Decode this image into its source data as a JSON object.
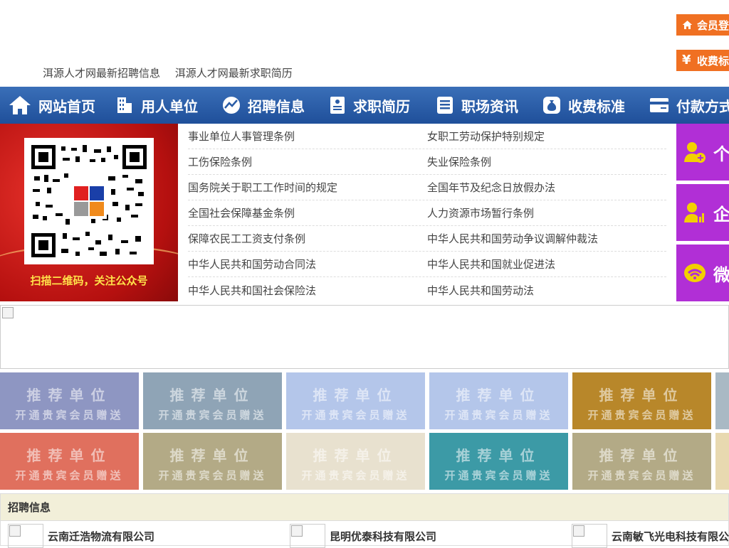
{
  "top_links": [
    "洱源人才网最新招聘信息",
    "洱源人才网最新求职简历"
  ],
  "side_buttons": [
    {
      "label": "会员登",
      "icon": "home-icon"
    },
    {
      "label": "收费标",
      "icon": "yen-icon"
    }
  ],
  "nav": [
    {
      "label": "网站首页",
      "icon": "home-icon"
    },
    {
      "label": "用人单位",
      "icon": "building-icon"
    },
    {
      "label": "招聘信息",
      "icon": "chart-icon"
    },
    {
      "label": "求职简历",
      "icon": "resume-icon"
    },
    {
      "label": "职场资讯",
      "icon": "news-icon"
    },
    {
      "label": "收费标准",
      "icon": "moneybag-icon"
    },
    {
      "label": "付款方式",
      "icon": "card-icon"
    }
  ],
  "qr": {
    "caption": "扫描二维码，关注公众号"
  },
  "laws": [
    [
      "事业单位人事管理条例",
      "女职工劳动保护特别规定"
    ],
    [
      "工伤保险条例",
      "失业保险条例"
    ],
    [
      "国务院关于职工工作时间的规定",
      "全国年节及纪念日放假办法"
    ],
    [
      "全国社会保障基金条例",
      "人力资源市场暂行条例"
    ],
    [
      "保障农民工工资支付条例",
      "中华人民共和国劳动争议调解仲裁法"
    ],
    [
      "中华人民共和国劳动合同法",
      "中华人民共和国就业促进法"
    ],
    [
      "中华人民共和国社会保险法",
      "中华人民共和国劳动法"
    ]
  ],
  "purple_tiles": [
    {
      "label": "个",
      "icon": "person-add-icon"
    },
    {
      "label": "企",
      "icon": "person-chart-icon"
    },
    {
      "label": "微",
      "icon": "wechat-icon"
    }
  ],
  "recommend": {
    "title": "推荐单位",
    "subtitle": "开通贵宾会员赠送",
    "colors": [
      "#8e96c2",
      "#8fa4b6",
      "#b4c6ea",
      "#b4c6ea",
      "#b8872a",
      "#a9b9c4",
      "#e0705e",
      "#b3aa86",
      "#e8e1cf",
      "#3c9aa6",
      "#b3aa86",
      "#e8d9b0"
    ]
  },
  "recruit": {
    "title": "招聘信息",
    "companies": [
      "云南迁浩物流有限公司",
      "昆明优泰科技有限公司",
      "云南敏飞光电科技有限公"
    ]
  }
}
